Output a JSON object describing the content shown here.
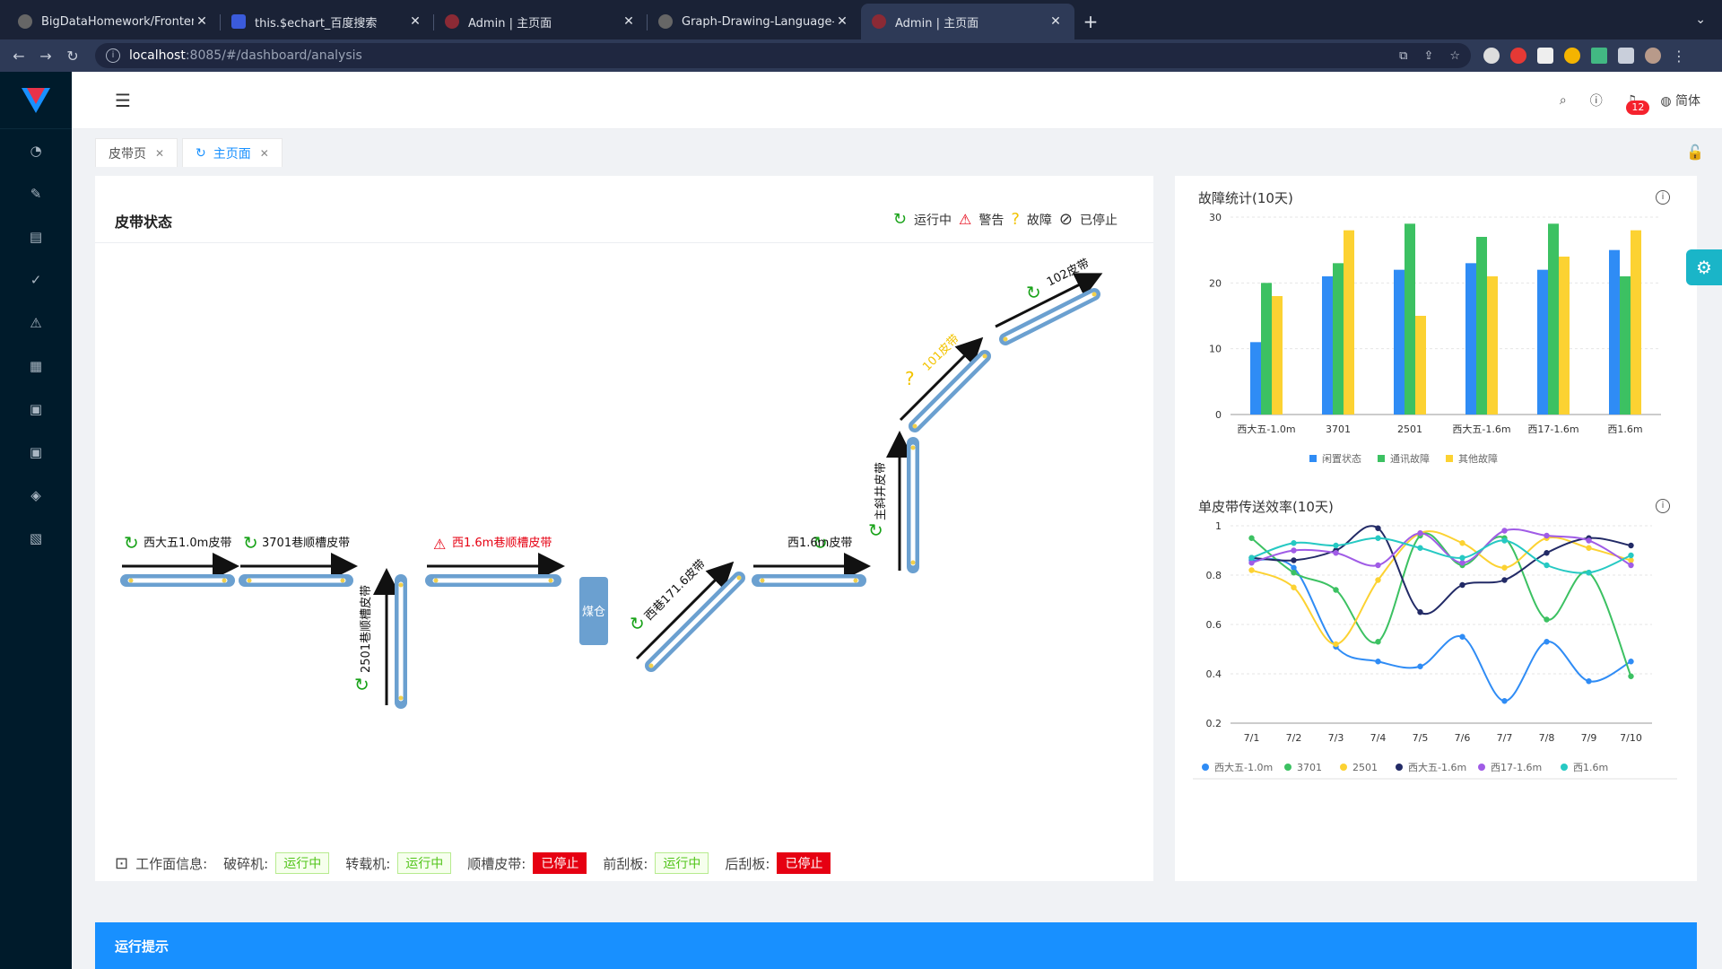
{
  "browser": {
    "tabs": [
      {
        "title": "BigDataHomework/Frontend at",
        "fav": "#555"
      },
      {
        "title": "this.$echart_百度搜索",
        "fav": "#3b5bdb"
      },
      {
        "title": "Admin | 主页面",
        "fav": "#8b2a35"
      },
      {
        "title": "Graph-Drawing-Language-Inte",
        "fav": "#555"
      },
      {
        "title": "Admin | 主页面",
        "fav": "#8b2a35"
      }
    ],
    "url_host": "localhost",
    "url_path": ":8085/#/dashboard/analysis"
  },
  "header": {
    "lang": "简体",
    "notifications": "12"
  },
  "page_tabs": [
    {
      "label": "皮带页"
    },
    {
      "label": "主页面"
    }
  ],
  "belt_card": {
    "title": "皮带状态",
    "legend": {
      "running": "运行中",
      "warning": "警告",
      "fault": "故障",
      "stopped": "已停止"
    },
    "belts": {
      "b1": "西大五1.0m皮带",
      "b2": "3701巷顺槽皮带",
      "b3": "2501巷顺槽皮带",
      "b4": "西1.6m巷顺槽皮带",
      "b5": "西巷171.6皮带",
      "b6": "西1.6m皮带",
      "b7": "主斜井皮带",
      "b8": "101皮带",
      "b9": "102皮带"
    },
    "bin": "煤仓",
    "workface": {
      "label": "工作面信息:",
      "items": [
        {
          "name": "破碎机:",
          "status": "运行中"
        },
        {
          "name": "转载机:",
          "status": "运行中"
        },
        {
          "name": "顺槽皮带:",
          "status": "已停止"
        },
        {
          "name": "前刮板:",
          "status": "运行中"
        },
        {
          "name": "后刮板:",
          "status": "已停止"
        }
      ]
    }
  },
  "charts_text": {
    "fault_title": "故障统计(10天)",
    "eff_title": "单皮带传送效率(10天)"
  },
  "chart_data": [
    {
      "type": "bar",
      "title": "故障统计(10天)",
      "categories": [
        "西大五-1.0m",
        "3701",
        "2501",
        "西大五-1.6m",
        "西17-1.6m",
        "西1.6m"
      ],
      "ylim": [
        0,
        30
      ],
      "yticks": [
        0,
        10,
        20,
        30
      ],
      "series": [
        {
          "name": "闲置状态",
          "color": "#2f8cf5",
          "values": [
            11,
            21,
            22,
            23,
            22,
            25
          ]
        },
        {
          "name": "通讯故障",
          "color": "#3cc162",
          "values": [
            20,
            23,
            29,
            27,
            29,
            21
          ]
        },
        {
          "name": "其他故障",
          "color": "#fcd232",
          "values": [
            18,
            28,
            15,
            21,
            24,
            28
          ]
        }
      ],
      "legend": "bottom-center"
    },
    {
      "type": "line",
      "title": "单皮带传送效率(10天)",
      "categories": [
        "7/1",
        "7/2",
        "7/3",
        "7/4",
        "7/5",
        "7/6",
        "7/7",
        "7/8",
        "7/9",
        "7/10"
      ],
      "ylim": [
        0.2,
        1
      ],
      "yticks": [
        0.2,
        0.4,
        0.6,
        0.8,
        1
      ],
      "series": [
        {
          "name": "西大五-1.0m",
          "color": "#2f8cf5",
          "values": [
            0.86,
            0.83,
            0.51,
            0.45,
            0.43,
            0.55,
            0.29,
            0.53,
            0.37,
            0.45
          ]
        },
        {
          "name": "3701",
          "color": "#3cc162",
          "values": [
            0.95,
            0.81,
            0.74,
            0.53,
            0.96,
            0.84,
            0.95,
            0.62,
            0.81,
            0.39
          ]
        },
        {
          "name": "2501",
          "color": "#fcd232",
          "values": [
            0.82,
            0.75,
            0.52,
            0.78,
            0.97,
            0.93,
            0.83,
            0.95,
            0.91,
            0.86
          ]
        },
        {
          "name": "西大五-1.6m",
          "color": "#222a66",
          "values": [
            0.87,
            0.86,
            0.9,
            0.99,
            0.65,
            0.76,
            0.78,
            0.89,
            0.95,
            0.92
          ]
        },
        {
          "name": "西17-1.6m",
          "color": "#a05ce6",
          "values": [
            0.85,
            0.9,
            0.89,
            0.84,
            0.97,
            0.85,
            0.98,
            0.96,
            0.94,
            0.84
          ]
        },
        {
          "name": "西1.6m",
          "color": "#26c9c3",
          "values": [
            0.87,
            0.93,
            0.92,
            0.95,
            0.91,
            0.87,
            0.94,
            0.84,
            0.81,
            0.88
          ]
        }
      ],
      "legend": "bottom-center"
    }
  ]
}
